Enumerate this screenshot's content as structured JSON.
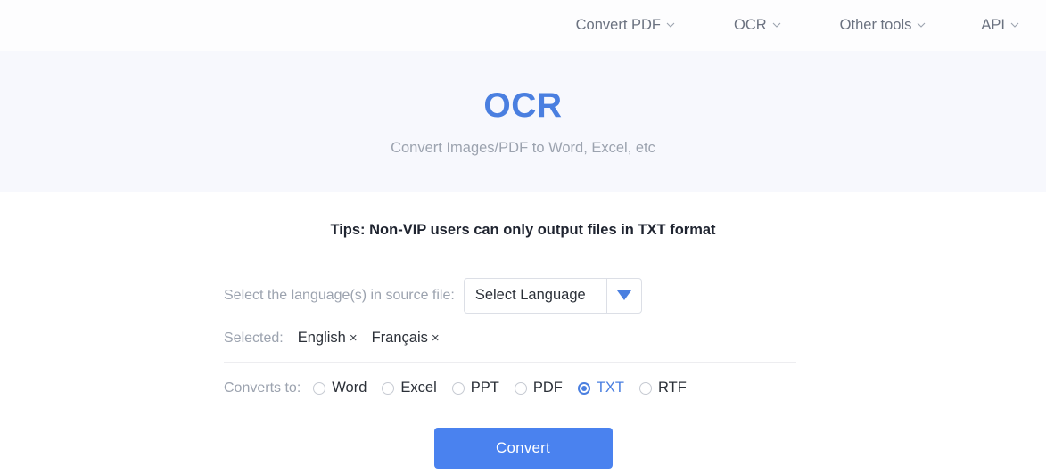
{
  "header": {
    "nav": [
      {
        "label": "Convert PDF",
        "icon": "chevron-down-icon"
      },
      {
        "label": "OCR",
        "icon": "chevron-down-icon"
      },
      {
        "label": "Other tools",
        "icon": "chevron-down-icon"
      },
      {
        "label": "API",
        "icon": "chevron-down-icon"
      }
    ]
  },
  "hero": {
    "title": "OCR",
    "subtitle": "Convert Images/PDF to Word, Excel, etc"
  },
  "main": {
    "tips": "Tips: Non-VIP users can only output files in TXT format",
    "language": {
      "label": "Select the language(s) in source file:",
      "select_value": "Select Language",
      "arrow_icon": "triangle-down-icon"
    },
    "selected": {
      "label": "Selected:",
      "items": [
        {
          "name": "English",
          "remove": "×"
        },
        {
          "name": "Français",
          "remove": "×"
        }
      ]
    },
    "converts": {
      "label": "Converts to:",
      "options": [
        {
          "label": "Word",
          "selected": false
        },
        {
          "label": "Excel",
          "selected": false
        },
        {
          "label": "PPT",
          "selected": false
        },
        {
          "label": "PDF",
          "selected": false
        },
        {
          "label": "TXT",
          "selected": true
        },
        {
          "label": "RTF",
          "selected": false
        }
      ]
    },
    "convert_button": "Convert"
  },
  "colors": {
    "accent": "#4a7fe0",
    "button": "#4a82ef",
    "banner": "#f7f8fd",
    "muted_text": "#9ca3af",
    "body_text": "#2b3038"
  }
}
